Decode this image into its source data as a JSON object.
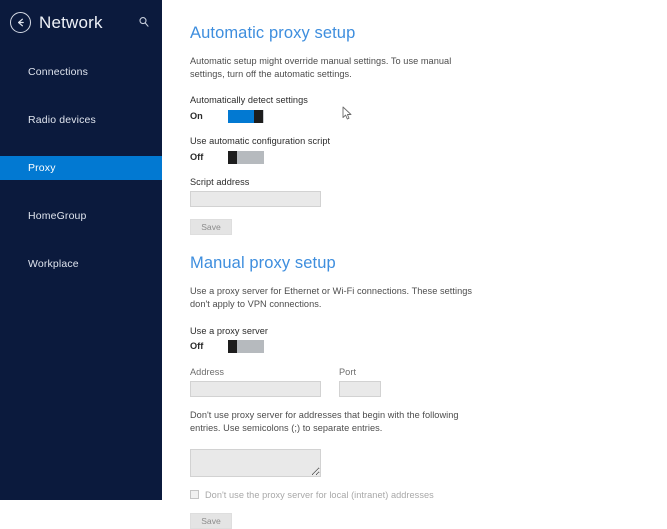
{
  "sidebar": {
    "title": "Network",
    "back_icon": "back-arrow-circle-icon",
    "search_icon": "search-icon",
    "items": [
      {
        "label": "Connections",
        "selected": false
      },
      {
        "label": "Radio devices",
        "selected": false
      },
      {
        "label": "Proxy",
        "selected": true
      },
      {
        "label": "HomeGroup",
        "selected": false
      },
      {
        "label": "Workplace",
        "selected": false
      }
    ],
    "colors": {
      "background": "#0b1a3d",
      "selected": "#0279d2",
      "text": "#dfe4ee"
    }
  },
  "automatic": {
    "title": "Automatic proxy setup",
    "description": "Automatic setup might override manual settings. To use manual settings, turn off the automatic settings.",
    "detect_label": "Automatically detect settings",
    "detect_state": "On",
    "script_toggle_label": "Use automatic configuration script",
    "script_toggle_state": "Off",
    "script_address_label": "Script address",
    "script_address_value": "",
    "save_label": "Save"
  },
  "manual": {
    "title": "Manual proxy setup",
    "description": "Use a proxy server for Ethernet or Wi-Fi connections. These settings don't apply to VPN connections.",
    "use_proxy_label": "Use a proxy server",
    "use_proxy_state": "Off",
    "address_label": "Address",
    "address_value": "",
    "port_label": "Port",
    "port_value": "",
    "exceptions_description": "Don't use proxy server for addresses that begin with the following entries. Use semicolons (;) to separate entries.",
    "exceptions_value": "",
    "local_bypass_label": "Don't use the proxy server for local (intranet) addresses",
    "local_bypass_checked": false,
    "save_label": "Save"
  },
  "theme": {
    "accent": "#0279d2",
    "heading": "#3e8ede"
  }
}
